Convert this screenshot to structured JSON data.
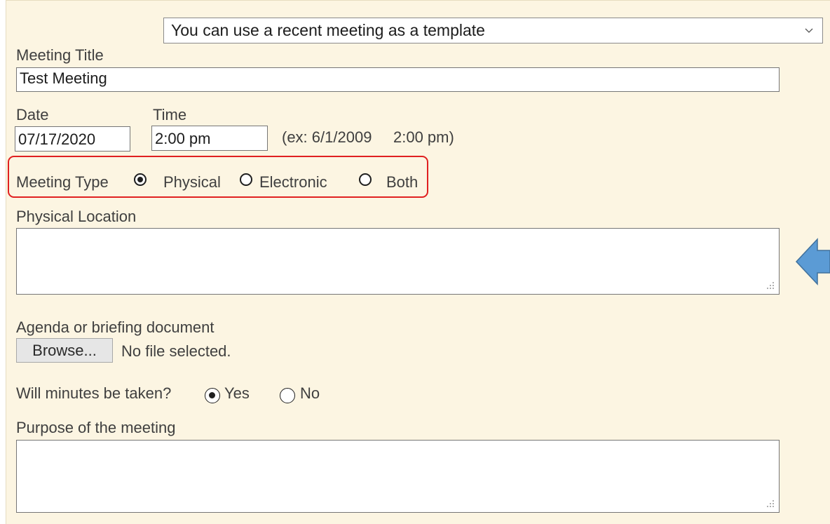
{
  "template_select": {
    "value": "You can use a recent meeting as a template"
  },
  "meeting_title": {
    "label": "Meeting Title",
    "value": "Test Meeting"
  },
  "date": {
    "label": "Date",
    "value": "07/17/2020"
  },
  "time": {
    "label": "Time",
    "value": "2:00 pm"
  },
  "datetime_hint": "(ex: 6/1/2009     2:00 pm)",
  "meeting_type": {
    "label": "Meeting Type",
    "options": [
      "Physical",
      "Electronic",
      "Both"
    ],
    "selected": "Physical"
  },
  "physical_location": {
    "label": "Physical Location",
    "value": ""
  },
  "agenda": {
    "label": "Agenda or briefing document",
    "browse_label": "Browse...",
    "file_status": "No file selected."
  },
  "minutes": {
    "label": "Will minutes be taken?",
    "options": [
      "Yes",
      "No"
    ],
    "selected": "Yes"
  },
  "purpose": {
    "label": "Purpose of the meeting",
    "value": ""
  },
  "colors": {
    "panel_background": "#fcf5e2",
    "highlight_border": "#e02020",
    "arrow_fill": "#5b9bd5"
  },
  "icons": {
    "select_chevron": "chevron-down-icon",
    "resize_grip": "resize-grip-icon",
    "annotation_arrow": "left-arrow-icon"
  }
}
